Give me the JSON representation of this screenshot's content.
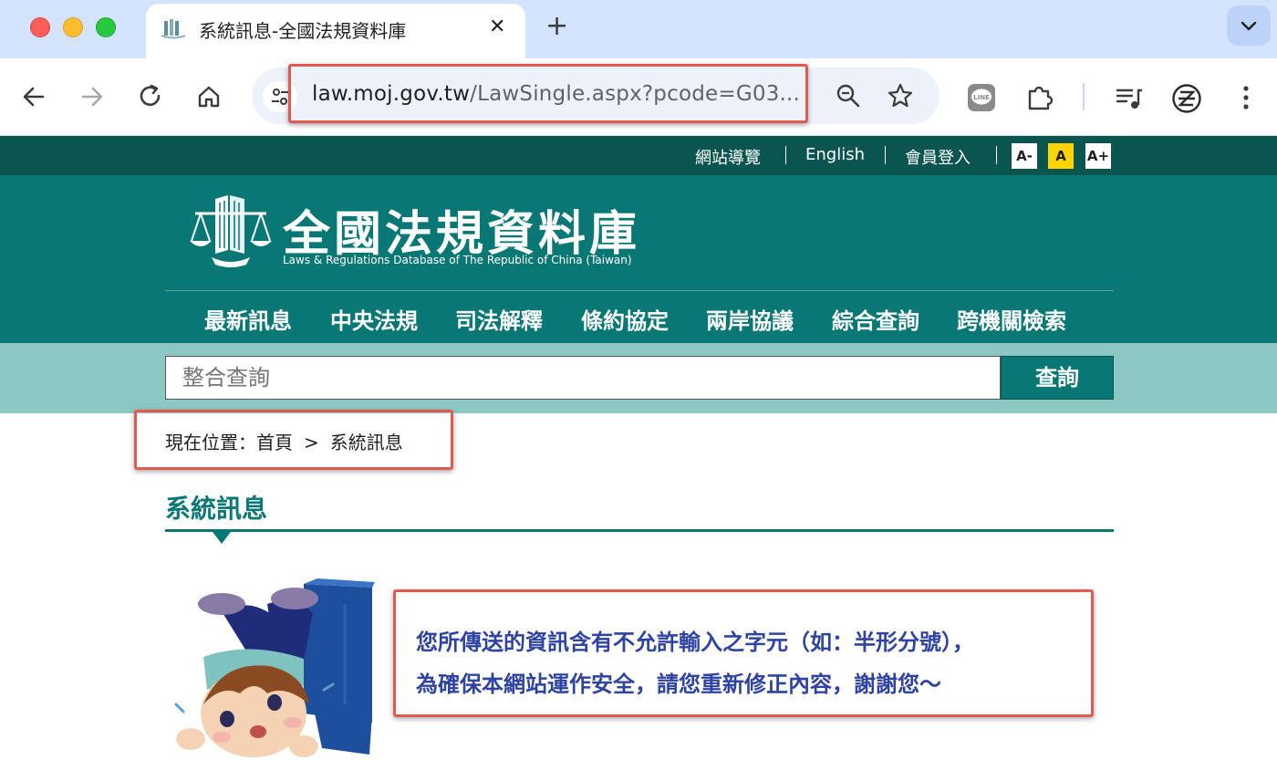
{
  "browser": {
    "tab_title": "系統訊息-全國法規資料庫",
    "tab_close": "✕",
    "new_tab": "+",
    "url_host": "law.moj.gov.tw",
    "url_path": "/LawSingle.aspx?pcode=G03..."
  },
  "site": {
    "util_links": [
      "網站導覽",
      "English",
      "會員登入"
    ],
    "font_sizes": [
      "A-",
      "A",
      "A+"
    ],
    "title": "全國法規資料庫",
    "subtitle": "Laws & Regulations Database of The Republic of China (Taiwan)",
    "nav": [
      "最新訊息",
      "中央法規",
      "司法解釋",
      "條約協定",
      "兩岸協議",
      "綜合查詢",
      "跨機關檢索"
    ],
    "search": {
      "placeholder": "整合查詢",
      "button": "查詢"
    }
  },
  "content": {
    "breadcrumb": {
      "prefix": "現在位置：",
      "home": "首頁",
      "sep": ">",
      "current": "系統訊息"
    },
    "page_title": "系統訊息",
    "message_lines": [
      "您所傳送的資訊含有不允許輸入之字元（如：半形分號），",
      "為確保本網站運作安全，請您重新修正內容，謝謝您～"
    ]
  },
  "colors": {
    "teal_dark": "#0b5551",
    "teal": "#097874",
    "teal_light": "#8dc7c3",
    "highlight_red": "#e05a50",
    "message_blue": "#2e43a2",
    "font_active": "#ffd400"
  }
}
